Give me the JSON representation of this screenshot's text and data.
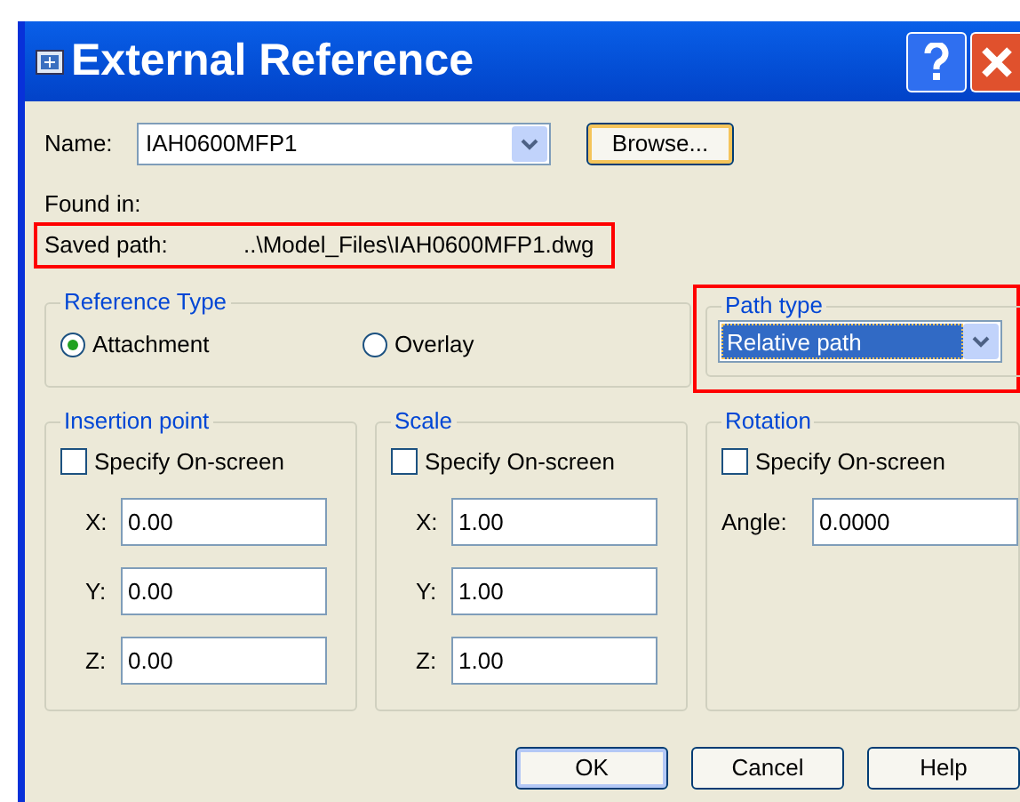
{
  "window": {
    "title": "External Reference"
  },
  "name_field": {
    "label": "Name:",
    "value": "IAH0600MFP1"
  },
  "browse_button": "Browse...",
  "found_in": {
    "label": "Found in:"
  },
  "saved_path": {
    "label": "Saved path:",
    "value": "..\\Model_Files\\IAH0600MFP1.dwg",
    "highlighted": true
  },
  "reference_type": {
    "title": "Reference Type",
    "options": [
      {
        "label": "Attachment",
        "selected": true
      },
      {
        "label": "Overlay",
        "selected": false
      }
    ]
  },
  "path_type": {
    "title": "Path type",
    "value": "Relative path",
    "highlighted": true
  },
  "groups": [
    {
      "title": "Insertion point",
      "checkbox": {
        "label": "Specify On-screen",
        "checked": false
      },
      "fields": [
        {
          "label": "X:",
          "value": "0.00"
        },
        {
          "label": "Y:",
          "value": "0.00"
        },
        {
          "label": "Z:",
          "value": "0.00"
        }
      ]
    },
    {
      "title": "Scale",
      "checkbox": {
        "label": "Specify On-screen",
        "checked": false
      },
      "fields": [
        {
          "label": "X:",
          "value": "1.00"
        },
        {
          "label": "Y:",
          "value": "1.00"
        },
        {
          "label": "Z:",
          "value": "1.00"
        }
      ]
    },
    {
      "title": "Rotation",
      "checkbox": {
        "label": "Specify On-screen",
        "checked": false
      },
      "fields": [
        {
          "label": "Angle:",
          "value": "0.0000"
        }
      ]
    }
  ],
  "buttons": [
    "OK",
    "Cancel",
    "Help"
  ]
}
